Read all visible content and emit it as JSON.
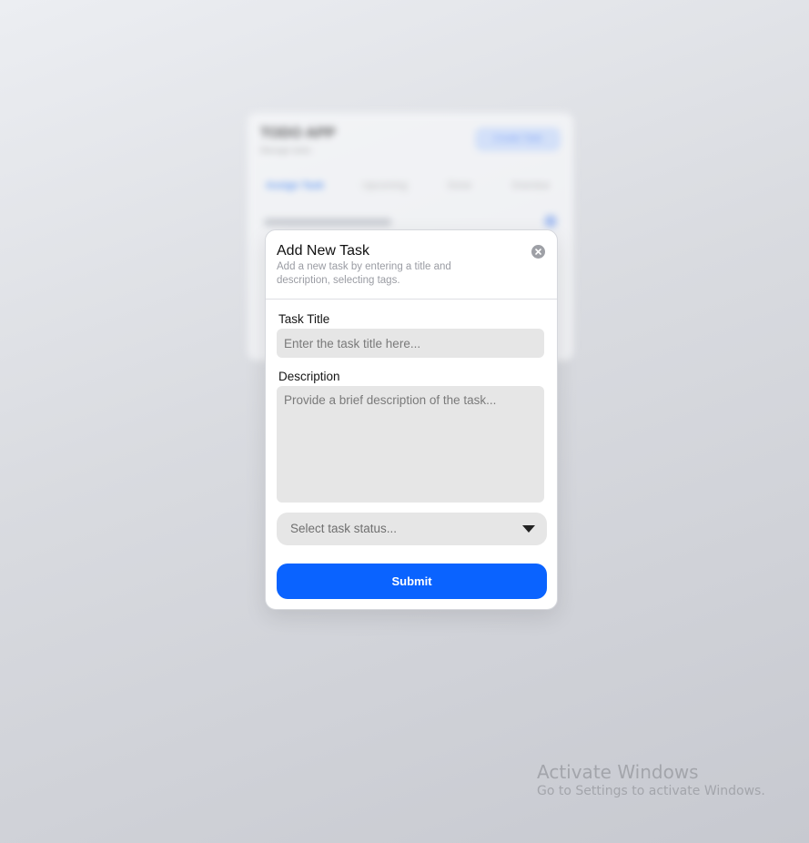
{
  "background_app": {
    "title": "TODO APP",
    "subtitle": "Manage tasks",
    "create_button": "Create Task",
    "tabs": [
      "Assign Task",
      "Upcoming",
      "Done",
      "Overdue"
    ],
    "row_text": ""
  },
  "modal": {
    "title": "Add New Task",
    "subtitle": "Add a new task by entering a title and description, selecting tags.",
    "close_icon": "close-circle-icon",
    "task_title_label": "Task Title",
    "task_title_placeholder": "Enter the task title here...",
    "description_label": "Description",
    "description_placeholder": "Provide a brief description of the task...",
    "status_select_placeholder": "Select task status...",
    "submit_label": "Submit"
  },
  "colors": {
    "accent": "#0a63ff",
    "field_bg": "#e6e6e6"
  },
  "watermark": {
    "title": "Activate Windows",
    "subtitle": "Go to Settings to activate Windows."
  }
}
